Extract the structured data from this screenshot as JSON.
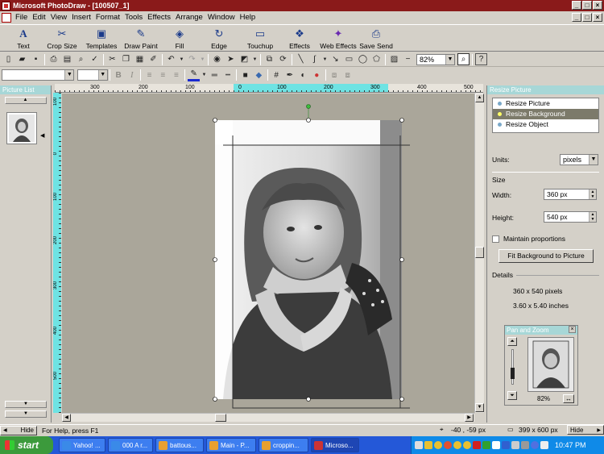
{
  "window": {
    "title": "Microsoft PhotoDraw - [100507_1]",
    "controls": [
      "_",
      "□",
      "×"
    ],
    "doc_controls": [
      "_",
      "□",
      "×"
    ]
  },
  "menu": [
    "File",
    "Edit",
    "View",
    "Insert",
    "Format",
    "Tools",
    "Effects",
    "Arrange",
    "Window",
    "Help"
  ],
  "big_toolbar": [
    {
      "label": "Text",
      "icon": "text-icon"
    },
    {
      "label": "Crop Size",
      "icon": "crop-icon"
    },
    {
      "label": "Templates",
      "icon": "templates-icon"
    },
    {
      "label": "Draw Paint",
      "icon": "brush-icon"
    },
    {
      "label": "Fill",
      "icon": "fill-icon"
    },
    {
      "label": "Edge",
      "icon": "edge-icon"
    },
    {
      "label": "Touchup",
      "icon": "touchup-icon"
    },
    {
      "label": "Effects",
      "icon": "effects-icon"
    },
    {
      "label": "Web Effects",
      "icon": "web-effects-icon"
    },
    {
      "label": "Save Send",
      "icon": "save-send-icon"
    }
  ],
  "standard_toolbar": {
    "zoom": "82%"
  },
  "picture_list": {
    "title": "Picture List",
    "scroll_up": "▲",
    "scroll_down": "▼",
    "hide": "Hide"
  },
  "ruler": {
    "h_labels": [
      "300",
      "200",
      "100",
      "0",
      "100",
      "200",
      "300",
      "400",
      "500"
    ],
    "v_labels": [
      "100",
      "0",
      "100",
      "200",
      "300",
      "400",
      "500"
    ]
  },
  "resize_panel": {
    "title": "Resize Picture",
    "options": [
      "Resize Picture",
      "Resize Background",
      "Resize Object"
    ],
    "selected_index": 1,
    "units_label": "Units:",
    "units_value": "pixels",
    "size_label": "Size",
    "width_label": "Width:",
    "width_value": "360 px",
    "height_label": "Height:",
    "height_value": "540 px",
    "maintain_label": "Maintain proportions",
    "fit_button": "Fit Background to Picture",
    "details_label": "Details",
    "details_pixels": "360 x 540 pixels",
    "details_inches": "3.60 x 5.40 inches",
    "hide": "Hide"
  },
  "pan_zoom": {
    "title": "Pan and Zoom",
    "zoom": "82%"
  },
  "status": {
    "help_text": "For Help, press F1",
    "position": "-40 , -59  px",
    "size": "399 x 600  px"
  },
  "taskbar": {
    "start": "start",
    "tasks": [
      "Yahoo! ...",
      "000 A r...",
      "battous...",
      "Main - P...",
      "croppin...",
      "Microso..."
    ],
    "active_index": 5,
    "clock": "10:47 PM"
  }
}
